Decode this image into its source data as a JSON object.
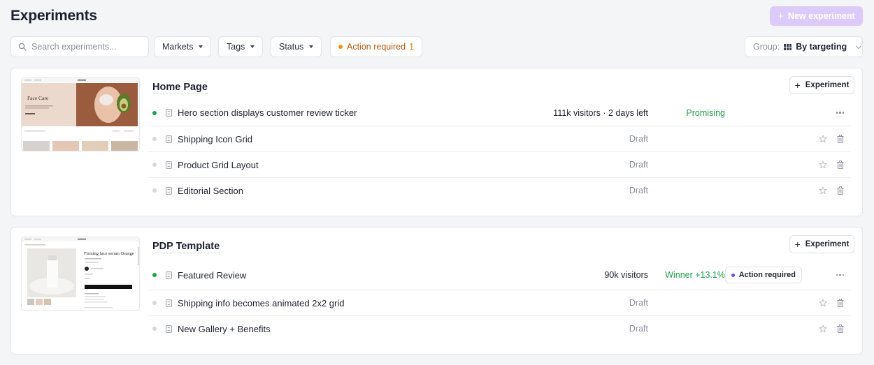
{
  "header": {
    "title": "Experiments",
    "new_button": "New experiment"
  },
  "toolbar": {
    "search_placeholder": "Search experiments...",
    "filters": {
      "markets": "Markets",
      "tags": "Tags",
      "status": "Status"
    },
    "action_required": {
      "label": "Action required",
      "count": "1"
    },
    "group": {
      "label": "Group:",
      "value": "By targeting"
    }
  },
  "groups": [
    {
      "title": "Home Page",
      "button": "Experiment",
      "thumbnail": {
        "headline": "Face Care"
      },
      "rows": [
        {
          "name": "Hero section displays customer review ticker",
          "meta": "111k visitors · 2 days left",
          "status": "Promising"
        },
        {
          "name": "Shipping Icon Grid",
          "meta": "Draft"
        },
        {
          "name": "Product Grid Layout",
          "meta": "Draft"
        },
        {
          "name": "Editorial Section",
          "meta": "Draft"
        }
      ]
    },
    {
      "title": "PDP Template",
      "button": "Experiment",
      "thumbnail": {
        "headline": "Firming face serum Orange"
      },
      "rows": [
        {
          "name": "Featured Review",
          "meta": "90k visitors",
          "status": "Winner +13.1%",
          "badge": "Action required"
        },
        {
          "name": "Shipping info becomes animated 2x2 grid",
          "meta": "Draft"
        },
        {
          "name": "New Gallery + Benefits",
          "meta": "Draft"
        }
      ]
    }
  ],
  "colors": {
    "accent": "#dccbfa",
    "success": "#1f9d49",
    "warning": "#f0920e",
    "badge_dot": "#6d4ae8"
  }
}
